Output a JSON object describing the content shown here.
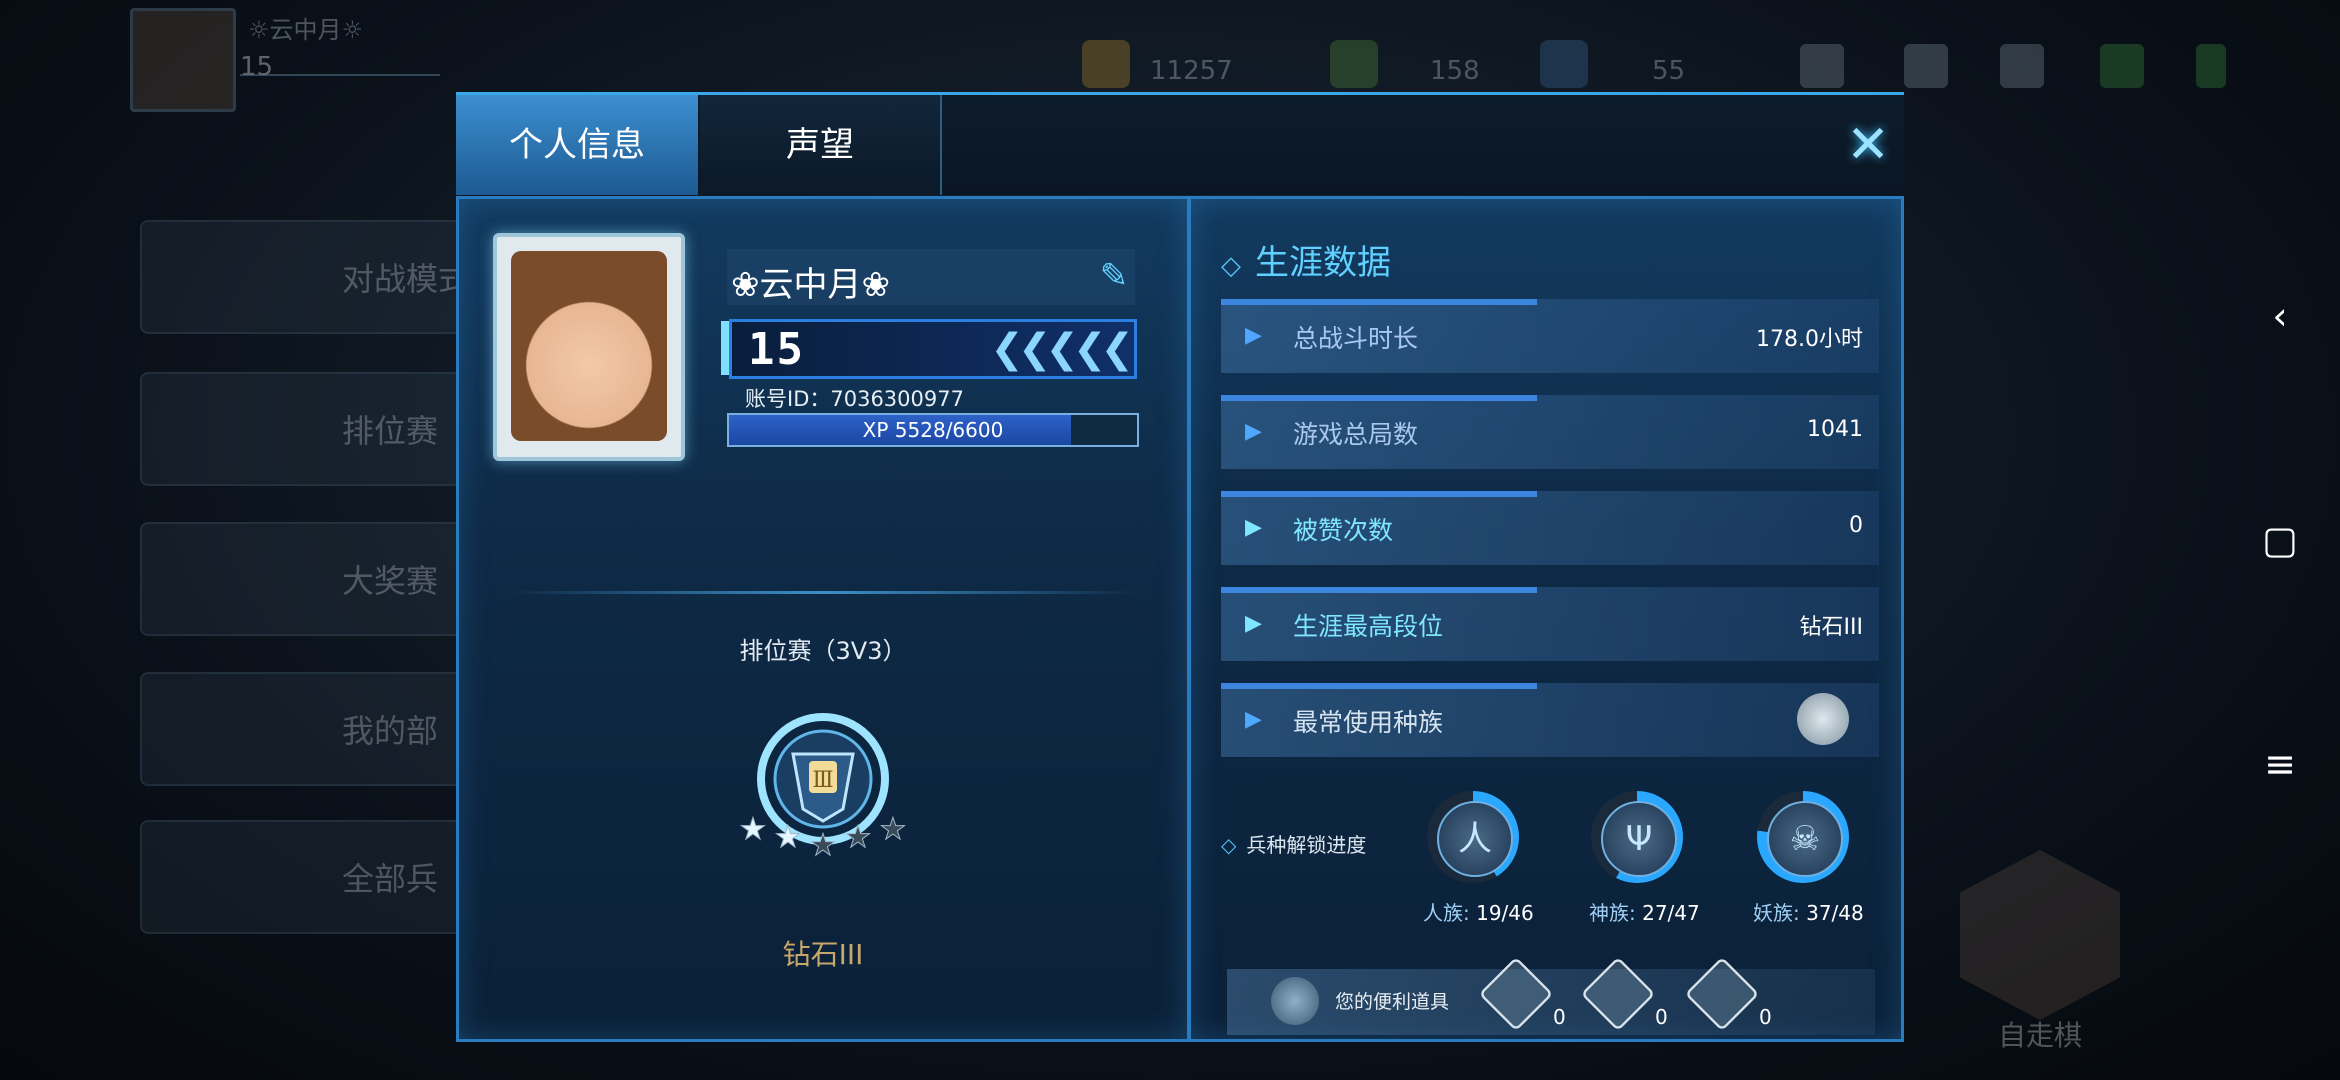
{
  "background": {
    "player_name": "☼云中月☼",
    "player_level": "15",
    "resources": [
      "11257",
      "158",
      "55"
    ],
    "menu": [
      "对战模式",
      "排位赛",
      "大奖赛",
      "我的部",
      "全部兵"
    ],
    "right_label": "自走棋"
  },
  "tabs": {
    "personal_info": "个人信息",
    "reputation": "声望"
  },
  "profile": {
    "name": "❀云中月❀",
    "level": "15",
    "account_id": "账号ID：7036300977",
    "xp_text": "XP 5528/6600",
    "xp_current": 5528,
    "xp_max": 6600
  },
  "rank": {
    "mode": "排位赛（3V3）",
    "tier_numeral": "Ⅲ",
    "name": "钻石III",
    "stars_filled": 2,
    "stars_total": 5
  },
  "career": {
    "title": "生涯数据",
    "stats": [
      {
        "label": "总战斗时长",
        "value": "178.0小时"
      },
      {
        "label": "游戏总局数",
        "value": "1041"
      },
      {
        "label": "被赞次数",
        "value": "0"
      },
      {
        "label": "生涯最高段位",
        "value": "钻石III"
      },
      {
        "label": "最常使用种族",
        "value": ""
      }
    ]
  },
  "unlock": {
    "title": "兵种解锁进度",
    "races": [
      {
        "label": "人族:",
        "progress": "19/46",
        "glyph": "人"
      },
      {
        "label": "神族:",
        "progress": "27/47",
        "glyph": "Ψ"
      },
      {
        "label": "妖族:",
        "progress": "37/48",
        "glyph": "☠"
      }
    ]
  },
  "items": {
    "label": "您的便利道具",
    "counts": [
      "0",
      "0",
      "0"
    ]
  },
  "colors": {
    "accent": "#3aa8e8",
    "cyan_text": "#5fd0ff",
    "gold_text": "#c8a86a"
  }
}
